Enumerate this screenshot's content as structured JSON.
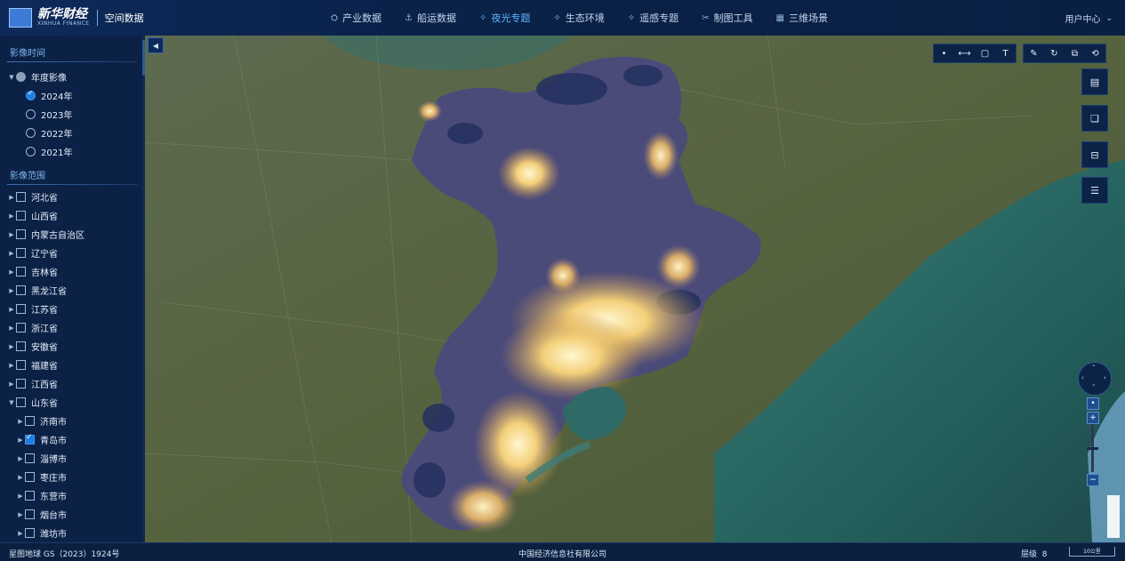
{
  "header": {
    "logo_text": "新华财经",
    "logo_sub": "XINHUA FINANCE",
    "app_title": "空间数据",
    "nav": [
      {
        "label": "产业数据",
        "icon": "layers-icon",
        "glyph": "⛭"
      },
      {
        "label": "船运数据",
        "icon": "anchor-icon",
        "glyph": "⚓"
      },
      {
        "label": "夜光专题",
        "icon": "satellite-icon",
        "glyph": "✧",
        "active": true
      },
      {
        "label": "生态环境",
        "icon": "satellite-icon",
        "glyph": "✧"
      },
      {
        "label": "遥感专题",
        "icon": "satellite-icon",
        "glyph": "✧"
      },
      {
        "label": "制图工具",
        "icon": "tools-icon",
        "glyph": "✂"
      },
      {
        "label": "三维场景",
        "icon": "map-3d-icon",
        "glyph": "▦"
      }
    ],
    "user_label": "用户中心"
  },
  "sidebar": {
    "time_section": "影像时间",
    "annual_group": "年度影像",
    "years": [
      {
        "label": "2024年",
        "checked": true
      },
      {
        "label": "2023年",
        "checked": false
      },
      {
        "label": "2022年",
        "checked": false
      },
      {
        "label": "2021年",
        "checked": false
      }
    ],
    "range_section": "影像范围",
    "provinces": [
      {
        "label": "河北省",
        "checked": false,
        "expanded": false
      },
      {
        "label": "山西省",
        "checked": false,
        "expanded": false
      },
      {
        "label": "内蒙古自治区",
        "checked": false,
        "expanded": false
      },
      {
        "label": "辽宁省",
        "checked": false,
        "expanded": false
      },
      {
        "label": "吉林省",
        "checked": false,
        "expanded": false
      },
      {
        "label": "黑龙江省",
        "checked": false,
        "expanded": false
      },
      {
        "label": "江苏省",
        "checked": false,
        "expanded": false
      },
      {
        "label": "浙江省",
        "checked": false,
        "expanded": false
      },
      {
        "label": "安徽省",
        "checked": false,
        "expanded": false
      },
      {
        "label": "福建省",
        "checked": false,
        "expanded": false
      },
      {
        "label": "江西省",
        "checked": false,
        "expanded": false
      },
      {
        "label": "山东省",
        "checked": false,
        "expanded": true
      }
    ],
    "cities": [
      {
        "label": "济南市",
        "checked": false
      },
      {
        "label": "青岛市",
        "checked": true
      },
      {
        "label": "淄博市",
        "checked": false
      },
      {
        "label": "枣庄市",
        "checked": false
      },
      {
        "label": "东营市",
        "checked": false
      },
      {
        "label": "烟台市",
        "checked": false
      },
      {
        "label": "潍坊市",
        "checked": false
      }
    ]
  },
  "toolbar": {
    "draw_tools": [
      {
        "name": "point-tool-icon",
        "glyph": "•"
      },
      {
        "name": "line-tool-icon",
        "glyph": "⟷"
      },
      {
        "name": "rectangle-tool-icon",
        "glyph": "▢"
      },
      {
        "name": "text-tool-icon",
        "glyph": "T"
      }
    ],
    "edit_tools": [
      {
        "name": "edit-icon",
        "glyph": "✎"
      },
      {
        "name": "rotate-icon",
        "glyph": "↻"
      },
      {
        "name": "export-icon",
        "glyph": "⧉"
      },
      {
        "name": "reset-icon",
        "glyph": "⟲"
      }
    ],
    "side_buttons": [
      {
        "name": "table-icon",
        "glyph": "▤"
      },
      {
        "name": "book-icon",
        "glyph": "❏"
      },
      {
        "name": "split-screen-icon",
        "glyph": "⊟"
      },
      {
        "name": "report-icon",
        "glyph": "☰"
      }
    ]
  },
  "zoom": {
    "plus": "+",
    "minus": "−"
  },
  "footer": {
    "copyright": "星图地球 GS（2023）1924号",
    "company": "中国经济信息社有限公司",
    "level_label": "层级",
    "level_value": "8",
    "scale_label": "10公里"
  },
  "colors": {
    "accent": "#5fb7ff",
    "glow_core": "#fff2c0",
    "glow_mid": "#f0c26a",
    "region_fill": "#4a4a78",
    "sea": "#2e6f6c"
  }
}
